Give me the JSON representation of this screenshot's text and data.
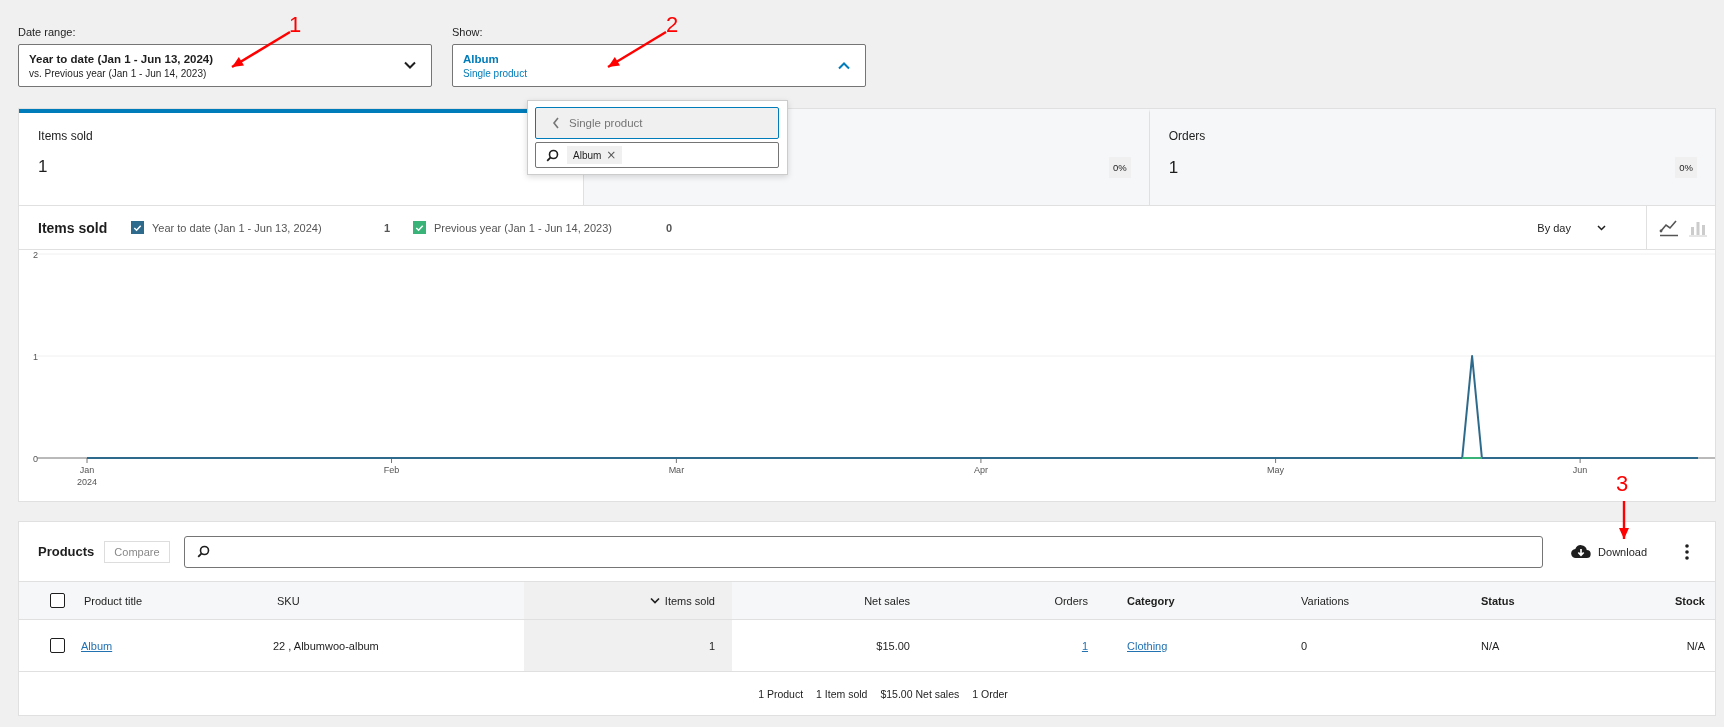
{
  "filters": [
    {
      "kind": "date",
      "label": "Date range:",
      "value": "Year to date (Jan 1 - Jun 13, 2024)",
      "subtext": "vs. Previous year (Jan 1 - Jun 14, 2023)",
      "expanded": false
    },
    {
      "kind": "show",
      "label": "Show:",
      "value": "Album",
      "subtext": "Single product",
      "expanded": true
    }
  ],
  "show_menu": {
    "back_label": "Single product",
    "chips": [
      {
        "label": "Album",
        "remove": "×"
      }
    ]
  },
  "summary_cards": [
    {
      "label": "Items sold",
      "value": "1",
      "selected": true
    },
    {
      "delta": "0%",
      "selected": false
    },
    {
      "label": "Orders",
      "value": "1",
      "delta": "0%",
      "selected": false
    }
  ],
  "chart_panel": {
    "title": "Items sold",
    "legend": [
      {
        "total": "1",
        "checked": true
      },
      {
        "total": "0",
        "checked": true
      }
    ],
    "interval": "By day",
    "chart_types": [
      {
        "kind": "line",
        "selected": true
      },
      {
        "kind": "bar",
        "selected": false
      }
    ],
    "chart_data": {
      "type": "line",
      "ylim": [
        0,
        2
      ],
      "yticks": [
        0,
        1,
        2
      ],
      "categories": [
        "Jan",
        null,
        null,
        null,
        null,
        null,
        null,
        null,
        null,
        null,
        null,
        null,
        null,
        null,
        null,
        null,
        null,
        null,
        null,
        null,
        null,
        null,
        null,
        null,
        null,
        null,
        null,
        null,
        null,
        null,
        null,
        "Feb",
        null,
        null,
        null,
        null,
        null,
        null,
        null,
        null,
        null,
        null,
        null,
        null,
        null,
        null,
        null,
        null,
        null,
        null,
        null,
        null,
        null,
        null,
        null,
        null,
        null,
        null,
        null,
        null,
        "Mar",
        null,
        null,
        null,
        null,
        null,
        null,
        null,
        null,
        null,
        null,
        null,
        null,
        null,
        null,
        null,
        null,
        null,
        null,
        null,
        null,
        null,
        null,
        null,
        null,
        null,
        null,
        null,
        null,
        null,
        null,
        "Apr",
        null,
        null,
        null,
        null,
        null,
        null,
        null,
        null,
        null,
        null,
        null,
        null,
        null,
        null,
        null,
        null,
        null,
        null,
        null,
        null,
        null,
        null,
        null,
        null,
        null,
        null,
        null,
        null,
        null,
        "May",
        null,
        null,
        null,
        null,
        null,
        null,
        null,
        null,
        null,
        null,
        null,
        null,
        null,
        null,
        null,
        null,
        null,
        null,
        null,
        null,
        null,
        null,
        null,
        null,
        null,
        null,
        null,
        null,
        null,
        null,
        "Jun",
        null,
        null,
        null,
        null,
        null,
        null,
        null,
        null,
        null,
        null,
        null,
        null
      ],
      "annotations": [
        "2024"
      ],
      "series": [
        {
          "name": "Year to date (Jan 1 - Jun 13, 2024)",
          "color": "#2e6a8c",
          "values": [
            0,
            0,
            0,
            0,
            0,
            0,
            0,
            0,
            0,
            0,
            0,
            0,
            0,
            0,
            0,
            0,
            0,
            0,
            0,
            0,
            0,
            0,
            0,
            0,
            0,
            0,
            0,
            0,
            0,
            0,
            0,
            0,
            0,
            0,
            0,
            0,
            0,
            0,
            0,
            0,
            0,
            0,
            0,
            0,
            0,
            0,
            0,
            0,
            0,
            0,
            0,
            0,
            0,
            0,
            0,
            0,
            0,
            0,
            0,
            0,
            0,
            0,
            0,
            0,
            0,
            0,
            0,
            0,
            0,
            0,
            0,
            0,
            0,
            0,
            0,
            0,
            0,
            0,
            0,
            0,
            0,
            0,
            0,
            0,
            0,
            0,
            0,
            0,
            0,
            0,
            0,
            0,
            0,
            0,
            0,
            0,
            0,
            0,
            0,
            0,
            0,
            0,
            0,
            0,
            0,
            0,
            0,
            0,
            0,
            0,
            0,
            0,
            0,
            0,
            0,
            0,
            0,
            0,
            0,
            0,
            0,
            0,
            0,
            0,
            0,
            0,
            0,
            0,
            0,
            0,
            0,
            0,
            0,
            0,
            0,
            0,
            0,
            0,
            0,
            0,
            0,
            1,
            0,
            0,
            0,
            0,
            0,
            0,
            0,
            0,
            0,
            0,
            0,
            0,
            0,
            0,
            0,
            0,
            0,
            0,
            0,
            0,
            0,
            0,
            0
          ]
        },
        {
          "name": "Previous year (Jan 1 - Jun 14, 2023)",
          "color": "#3ab378",
          "values": [
            null,
            null,
            null,
            null,
            null,
            null,
            null,
            null,
            null,
            null,
            null,
            null,
            null,
            null,
            null,
            null,
            null,
            null,
            null,
            null,
            null,
            null,
            null,
            null,
            null,
            null,
            null,
            null,
            null,
            null,
            null,
            null,
            null,
            null,
            null,
            null,
            null,
            null,
            null,
            null,
            null,
            null,
            null,
            null,
            null,
            null,
            null,
            null,
            null,
            null,
            null,
            null,
            null,
            null,
            null,
            null,
            null,
            null,
            null,
            null,
            null,
            null,
            null,
            null,
            null,
            null,
            null,
            null,
            null,
            null,
            null,
            null,
            null,
            null,
            null,
            null,
            null,
            null,
            null,
            null,
            null,
            null,
            null,
            null,
            null,
            null,
            null,
            null,
            null,
            null,
            null,
            null,
            null,
            null,
            null,
            null,
            null,
            null,
            null,
            null,
            null,
            null,
            null,
            null,
            null,
            null,
            null,
            null,
            null,
            null,
            null,
            null,
            null,
            null,
            null,
            null,
            null,
            null,
            null,
            null,
            null,
            null,
            null,
            null,
            null,
            null,
            null,
            null,
            null,
            null,
            null,
            null,
            null,
            null,
            null,
            null,
            null,
            null,
            null,
            null,
            0,
            0,
            0,
            null,
            null,
            null,
            null,
            null,
            null,
            null,
            null,
            null,
            null,
            null,
            null,
            null,
            null,
            null,
            null,
            null,
            null,
            null,
            null,
            null,
            null
          ]
        }
      ]
    }
  },
  "products": {
    "title": "Products",
    "compare": "Compare",
    "download": "Download",
    "header_checked": false,
    "columns": [
      {
        "label": "Product title",
        "sortable": true,
        "sorted": false
      },
      {
        "label": "SKU",
        "sortable": true,
        "sorted": false
      },
      {
        "label": "Items sold",
        "sortable": true,
        "sorted": true
      },
      {
        "label": "Net sales",
        "sortable": true,
        "sorted": false
      },
      {
        "label": "Orders",
        "sortable": true,
        "sorted": false
      },
      {
        "label": "Category",
        "sortable": false,
        "sorted": false
      },
      {
        "label": "Variations",
        "sortable": true,
        "sorted": false
      },
      {
        "label": "Status",
        "sortable": false,
        "sorted": false
      },
      {
        "label": "Stock",
        "sortable": false,
        "sorted": false
      }
    ],
    "rows": [
      {
        "selected": false,
        "cells": [
          {
            "text": "Album",
            "link": true
          },
          {
            "text": "22 , Albumwoo-album",
            "link": false
          },
          {
            "text": "1",
            "link": false
          },
          {
            "text": "$15.00",
            "link": false
          },
          {
            "text": "1",
            "link": true
          },
          {
            "text": "Clothing",
            "link": true
          },
          {
            "text": "0",
            "link": false
          },
          {
            "text": "N/A",
            "link": false
          },
          {
            "text": "N/A",
            "link": false
          }
        ]
      }
    ],
    "summary": [
      "1 Product",
      "1 Item sold",
      "$15.00 Net sales",
      "1 Order"
    ]
  },
  "callouts": [
    {
      "number": "1"
    },
    {
      "number": "2"
    },
    {
      "number": "3"
    }
  ]
}
